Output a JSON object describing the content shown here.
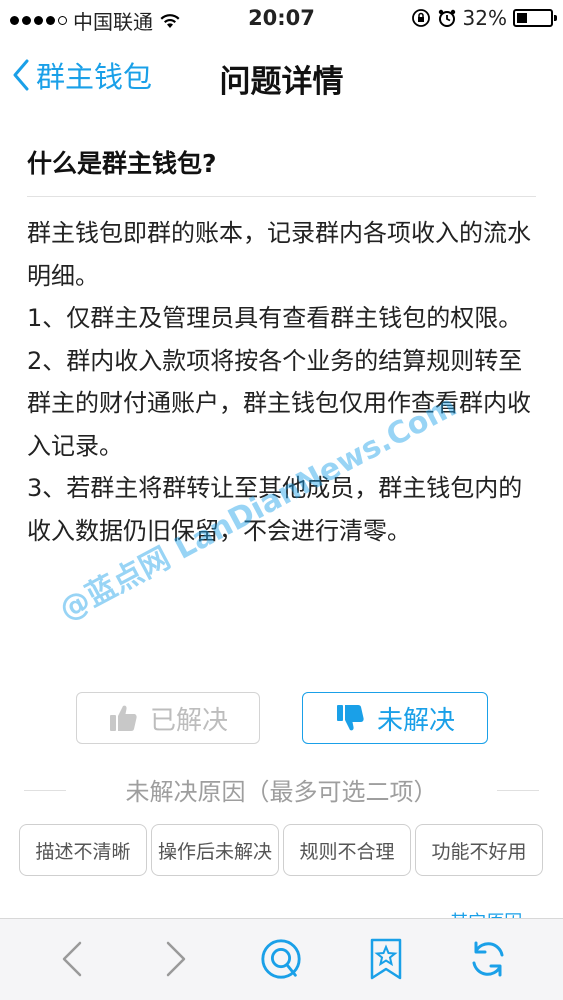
{
  "statusbar": {
    "carrier": "中国联通",
    "time": "20:07",
    "battery": "32%",
    "battery_level": 0.32
  },
  "nav": {
    "back_label": "群主钱包",
    "title": "问题详情"
  },
  "question": {
    "title": "什么是群主钱包?",
    "paragraphs": [
      "群主钱包即群的账本，记录群内各项收入的流水明细。",
      "1、仅群主及管理员具有查看群主钱包的权限。",
      "2、群内收入款项将按各个业务的结算规则转至群主的财付通账户，群主钱包仅用作查看群内收入记录。",
      "3、若群主将群转让至其他成员，群主钱包内的收入数据仍旧保留，不会进行清零。"
    ]
  },
  "feedback": {
    "solved_label": "已解决",
    "unsolved_label": "未解决",
    "reason_title": "未解决原因（最多可选二项）",
    "reasons": [
      "描述不清晰",
      "操作后未解决",
      "规则不合理",
      "功能不好用"
    ],
    "other_label": "其它原因 »"
  },
  "watermark": "@蓝点网 LanDianNews.Com",
  "colors": {
    "accent": "#1aa0e8",
    "muted": "#bdbdbd"
  },
  "toolbar": {
    "icons": [
      "back-arrow-icon",
      "forward-arrow-icon",
      "qq-browser-icon",
      "bookmark-star-icon",
      "refresh-icon"
    ]
  }
}
